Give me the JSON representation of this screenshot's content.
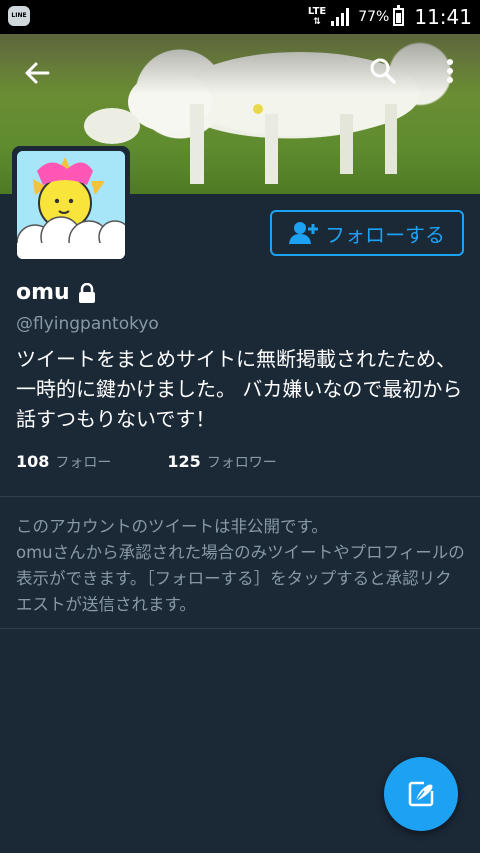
{
  "status_bar": {
    "app_icon_label": "LINE",
    "network": "LTE",
    "battery": "77%",
    "time": "11:41"
  },
  "profile": {
    "display_name": "omu",
    "handle": "@flyingpantokyo",
    "bio": "ツイートをまとめサイトに無断掲載されたため、一時的に鍵かけました。 バカ嫌いなので最初から話すつもりないです！",
    "following_count": "108",
    "following_label": "フォロー",
    "followers_count": "125",
    "followers_label": "フォロワー"
  },
  "actions": {
    "follow_label": "フォローする"
  },
  "protected_notice": {
    "line1": "このアカウントのツイートは非公開です。",
    "line2": "omuさんから承認された場合のみツイートやプロフィールの表示ができます。［フォローする］をタップすると承認リクエストが送信されます。"
  },
  "icons": {
    "back": "arrow-left-icon",
    "search": "search-icon",
    "more": "more-vertical-icon",
    "lock": "lock-icon",
    "follow": "person-add-icon",
    "compose": "compose-tweet-icon"
  },
  "colors": {
    "background": "#1b2836",
    "accent": "#1da1f2",
    "secondary_text": "#8899a6"
  }
}
